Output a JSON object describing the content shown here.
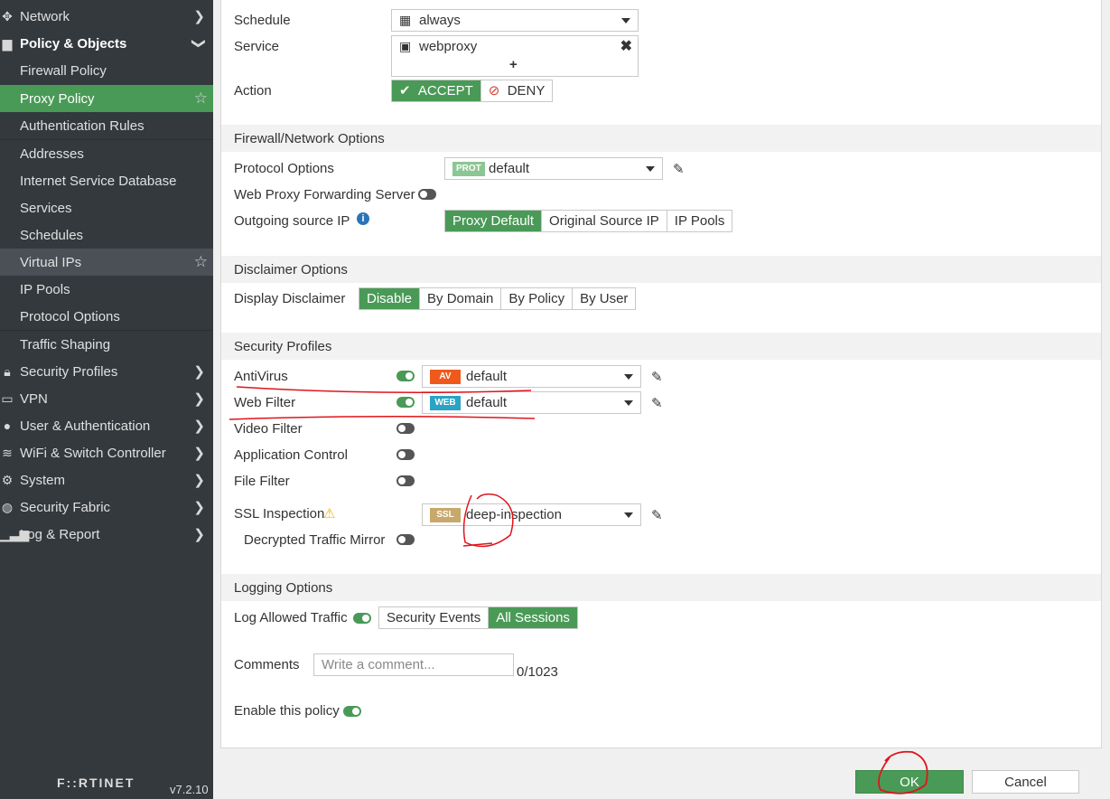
{
  "sidebar": {
    "items": [
      {
        "label": "Network",
        "icon": "network-icon"
      },
      {
        "label": "Policy & Objects",
        "icon": "policy-objects-icon"
      },
      {
        "label": "Firewall Policy"
      },
      {
        "label": "Proxy Policy"
      },
      {
        "label": "Authentication Rules"
      },
      {
        "label": "Addresses"
      },
      {
        "label": "Internet Service Database"
      },
      {
        "label": "Services"
      },
      {
        "label": "Schedules"
      },
      {
        "label": "Virtual IPs"
      },
      {
        "label": "IP Pools"
      },
      {
        "label": "Protocol Options"
      },
      {
        "label": "Traffic Shaping"
      },
      {
        "label": "Security Profiles",
        "icon": "lock-icon"
      },
      {
        "label": "VPN",
        "icon": "vpn-monitor-icon"
      },
      {
        "label": "User & Authentication",
        "icon": "user-icon"
      },
      {
        "label": "WiFi & Switch Controller",
        "icon": "wifi-icon"
      },
      {
        "label": "System",
        "icon": "gear-icon"
      },
      {
        "label": "Security Fabric",
        "icon": "fabric-icon"
      },
      {
        "label": "Log & Report",
        "icon": "chart-icon"
      }
    ],
    "brand": "F::RTINET",
    "version": "v7.2.10"
  },
  "form": {
    "schedule": {
      "label": "Schedule",
      "value": "always"
    },
    "service": {
      "label": "Service",
      "value": "webproxy",
      "add": "+"
    },
    "action": {
      "label": "Action",
      "accept": "ACCEPT",
      "deny": "DENY"
    }
  },
  "firewall_network": {
    "header": "Firewall/Network Options",
    "protocol_options": {
      "label": "Protocol Options",
      "badge": "PROT",
      "value": "default"
    },
    "forwarding_server": {
      "label": "Web Proxy Forwarding Server",
      "enabled": false
    },
    "outgoing_ip": {
      "label": "Outgoing source IP",
      "options": [
        "Proxy Default",
        "Original Source IP",
        "IP Pools"
      ],
      "selected": "Proxy Default"
    }
  },
  "disclaimer": {
    "header": "Disclaimer Options",
    "display": {
      "label": "Display Disclaimer",
      "options": [
        "Disable",
        "By Domain",
        "By Policy",
        "By User"
      ],
      "selected": "Disable"
    }
  },
  "security_profiles": {
    "header": "Security Profiles",
    "antivirus": {
      "label": "AntiVirus",
      "badge": "AV",
      "value": "default",
      "enabled": true
    },
    "web_filter": {
      "label": "Web Filter",
      "badge": "WEB",
      "value": "default",
      "enabled": true
    },
    "video_filter": {
      "label": "Video Filter",
      "enabled": false
    },
    "app_control": {
      "label": "Application Control",
      "enabled": false
    },
    "file_filter": {
      "label": "File Filter",
      "enabled": false
    },
    "ssl_inspection": {
      "label": "SSL Inspection",
      "badge": "SSL",
      "value": "deep-inspection"
    },
    "decrypted_mirror": {
      "label": "Decrypted Traffic Mirror",
      "enabled": false
    }
  },
  "logging": {
    "header": "Logging Options",
    "log_allowed": {
      "label": "Log Allowed Traffic",
      "enabled": true,
      "options": [
        "Security Events",
        "All Sessions"
      ],
      "selected": "All Sessions"
    }
  },
  "comments": {
    "label": "Comments",
    "placeholder": "Write a comment...",
    "counter": "0/1023"
  },
  "enable_policy": {
    "label": "Enable this policy",
    "enabled": true
  },
  "footer": {
    "ok": "OK",
    "cancel": "Cancel"
  },
  "colors": {
    "accent": "#4a9a57",
    "sidebar": "#33393d",
    "annotation": "#e0141c",
    "av_badge": "#ef5a1c",
    "web_badge": "#2aa3c4",
    "ssl_badge": "#c8a86b",
    "prot_badge": "#8cc694"
  }
}
